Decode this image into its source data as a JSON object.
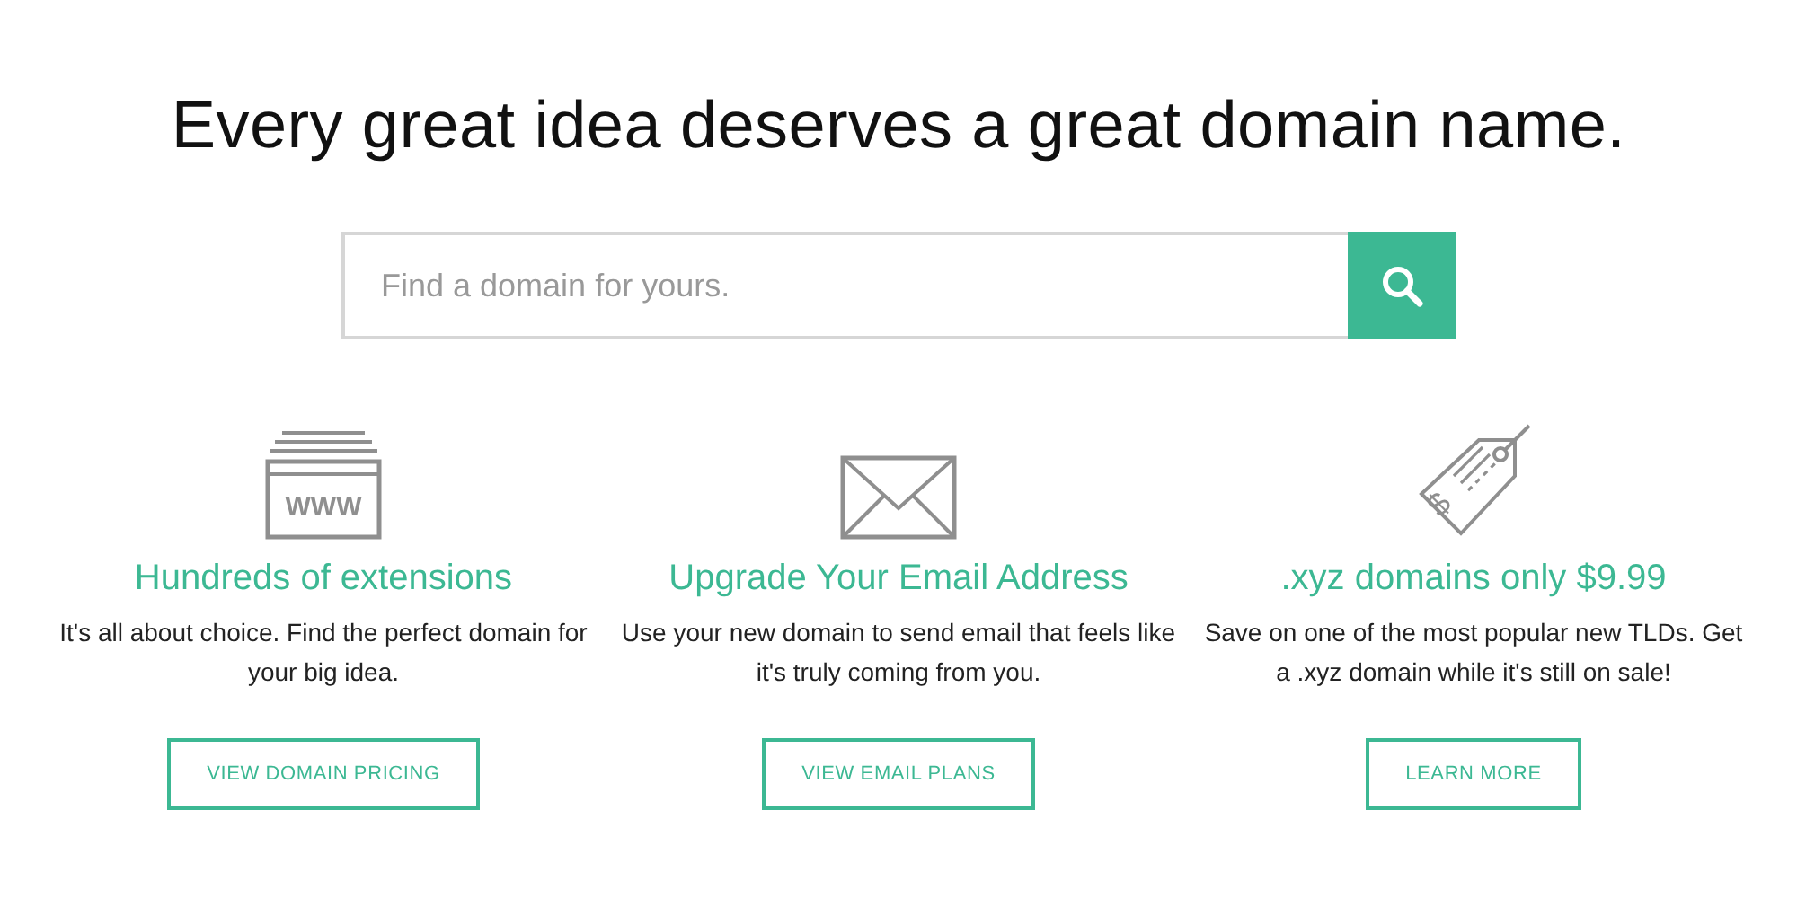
{
  "heading": "Every great idea deserves a great domain name.",
  "search": {
    "placeholder": "Find a domain for yours."
  },
  "features": [
    {
      "kind": "browser",
      "icon_text": "WWW",
      "title": "Hundreds of extensions",
      "description": "It's all about choice. Find the perfect domain for your big idea.",
      "button": "VIEW DOMAIN PRICING"
    },
    {
      "kind": "envelope",
      "title": "Upgrade Your Email Address",
      "description": "Use your new domain to send email that feels like it's truly coming from you.",
      "button": "VIEW EMAIL PLANS"
    },
    {
      "kind": "tag",
      "icon_text": "$",
      "title": ".xyz domains only $9.99",
      "description": "Save on one of the most popular new TLDs. Get a .xyz domain while it's still on sale!",
      "button": "LEARN MORE"
    }
  ]
}
